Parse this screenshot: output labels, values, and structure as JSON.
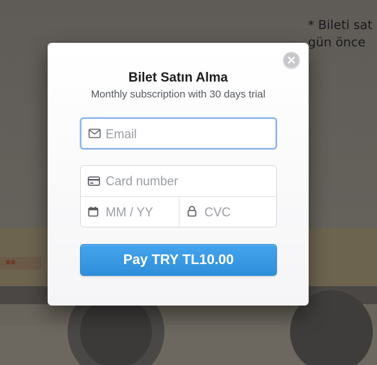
{
  "background": {
    "note_line1": "* Bileti sat",
    "note_line2": "gün önce"
  },
  "modal": {
    "title": "Bilet Satın Alma",
    "subtitle": "Monthly subscription with 30 days trial",
    "close_icon": "close-icon",
    "email": {
      "placeholder": "Email",
      "value": "",
      "icon": "mail-icon"
    },
    "card_number": {
      "placeholder": "Card number",
      "value": "",
      "icon": "credit-card-icon"
    },
    "expiry": {
      "placeholder": "MM / YY",
      "value": "",
      "icon": "calendar-icon"
    },
    "cvc": {
      "placeholder": "CVC",
      "value": "",
      "icon": "lock-icon"
    },
    "pay_button_label": "Pay TRY TL10.00"
  },
  "colors": {
    "accent": "#3398e4",
    "focus_border": "#8cb2ea",
    "title_text": "#1e1e1e",
    "placeholder": "#9b9ea4"
  }
}
